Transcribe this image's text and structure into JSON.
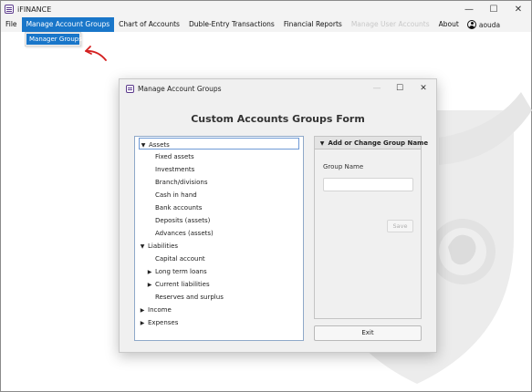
{
  "app": {
    "title": "iFINANCE",
    "window_controls": {
      "minimize": "—",
      "maximize": "☐",
      "close": "✕"
    }
  },
  "menu": {
    "items": [
      {
        "label": "File",
        "state": "normal"
      },
      {
        "label": "Manage Account Groups",
        "state": "active"
      },
      {
        "label": "Chart of Accounts",
        "state": "normal"
      },
      {
        "label": "Duble-Entry Transactions",
        "state": "normal"
      },
      {
        "label": "Financial Reports",
        "state": "normal"
      },
      {
        "label": "Manage User Accounts",
        "state": "disabled"
      },
      {
        "label": "About",
        "state": "normal"
      }
    ],
    "user": "aouda",
    "dropdown": {
      "items": [
        {
          "label": "Manager Groups"
        }
      ]
    }
  },
  "dialog": {
    "title": "Manage Account Groups",
    "controls": {
      "minimize": "—",
      "maximize": "☐",
      "close": "✕"
    },
    "heading": "Custom Accounts Groups Form",
    "tree": [
      {
        "label": "Assets",
        "level": 0,
        "toggle": "▼",
        "selected": true
      },
      {
        "label": "Fixed assets",
        "level": 1,
        "toggle": ""
      },
      {
        "label": "Investments",
        "level": 1,
        "toggle": ""
      },
      {
        "label": "Branch/divisions",
        "level": 1,
        "toggle": ""
      },
      {
        "label": "Cash in hand",
        "level": 1,
        "toggle": ""
      },
      {
        "label": "Bank accounts",
        "level": 1,
        "toggle": ""
      },
      {
        "label": "Deposits (assets)",
        "level": 1,
        "toggle": ""
      },
      {
        "label": "Advances (assets)",
        "level": 1,
        "toggle": ""
      },
      {
        "label": "Liabilities",
        "level": 0,
        "toggle": "▼"
      },
      {
        "label": "Capital account",
        "level": 1,
        "toggle": ""
      },
      {
        "label": "Long term loans",
        "level": 1,
        "toggle": "▶"
      },
      {
        "label": "Current liabilities",
        "level": 1,
        "toggle": "▶"
      },
      {
        "label": "Reserves and surplus",
        "level": 1,
        "toggle": ""
      },
      {
        "label": "Income",
        "level": 0,
        "toggle": "▶"
      },
      {
        "label": "Expenses",
        "level": 0,
        "toggle": "▶"
      }
    ],
    "panel": {
      "toggle": "▼",
      "title": "Add or Change Group Name",
      "field_label": "Group Name",
      "field_value": "",
      "save_label": "Save"
    },
    "exit_label": "Exit"
  },
  "colors": {
    "accent": "#1976c9",
    "annotation_arrow": "#d42020",
    "tree_border": "#8fa9c9"
  }
}
